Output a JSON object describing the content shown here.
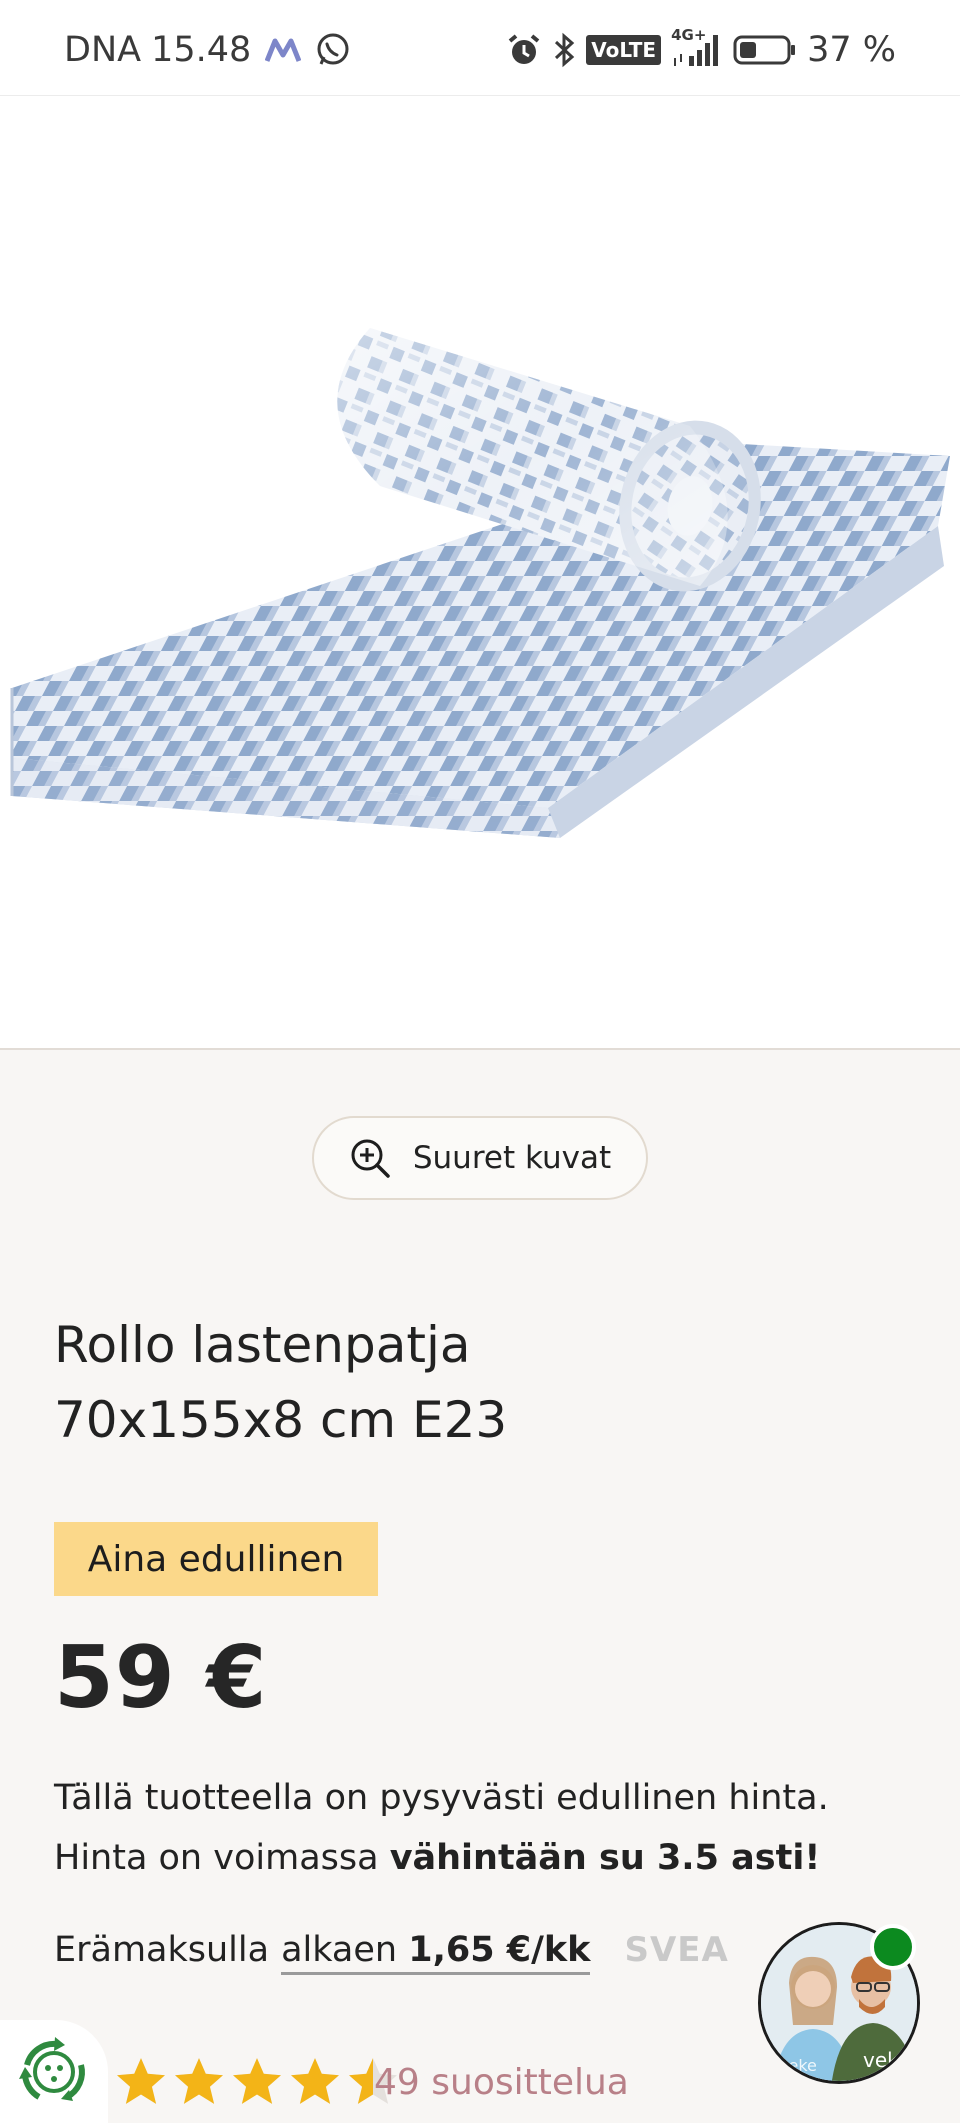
{
  "status_bar": {
    "carrier": "DNA",
    "time": "15.48",
    "network": "VoLTE",
    "signal_label": "4G+",
    "battery_level": "37 %",
    "battery_fraction": 0.37,
    "icons": [
      "m-app-icon",
      "whatsapp-icon",
      "alarm-icon",
      "bluetooth-icon",
      "volte-icon",
      "signal-icon",
      "battery-icon"
    ]
  },
  "product_image": {
    "icon": "rolled-mattress-image"
  },
  "zoom_button": {
    "label": "Suuret kuvat",
    "icon": "zoom-in-icon"
  },
  "product": {
    "title_line1": "Rollo lastenpatja",
    "title_line2": "70x155x8 cm E23",
    "badge": "Aina edullinen",
    "price": "59 €",
    "description_line1": "Tällä tuotteella on pysyvästi edullinen hinta.",
    "description_line2_prefix": "Hinta on voimassa ",
    "description_line2_bold": "vähintään su 3.5 asti!"
  },
  "installment": {
    "prefix": "Erämaksulla",
    "link_text": "alkaen",
    "amount": "1,65 €/kk",
    "provider": "SVEA"
  },
  "rating": {
    "stars_value": 4.5,
    "stars_max": 5,
    "count_text": "49 suosittelua"
  },
  "chat": {
    "avatar_brand": "veke",
    "status": "online"
  },
  "colors": {
    "background": "#f8f6f4",
    "badge": "#fbd88a",
    "star": "#f3b417",
    "online": "#0c8a1f",
    "rating_text": "#b88088",
    "mattress_blue": "#8fa9cc"
  }
}
